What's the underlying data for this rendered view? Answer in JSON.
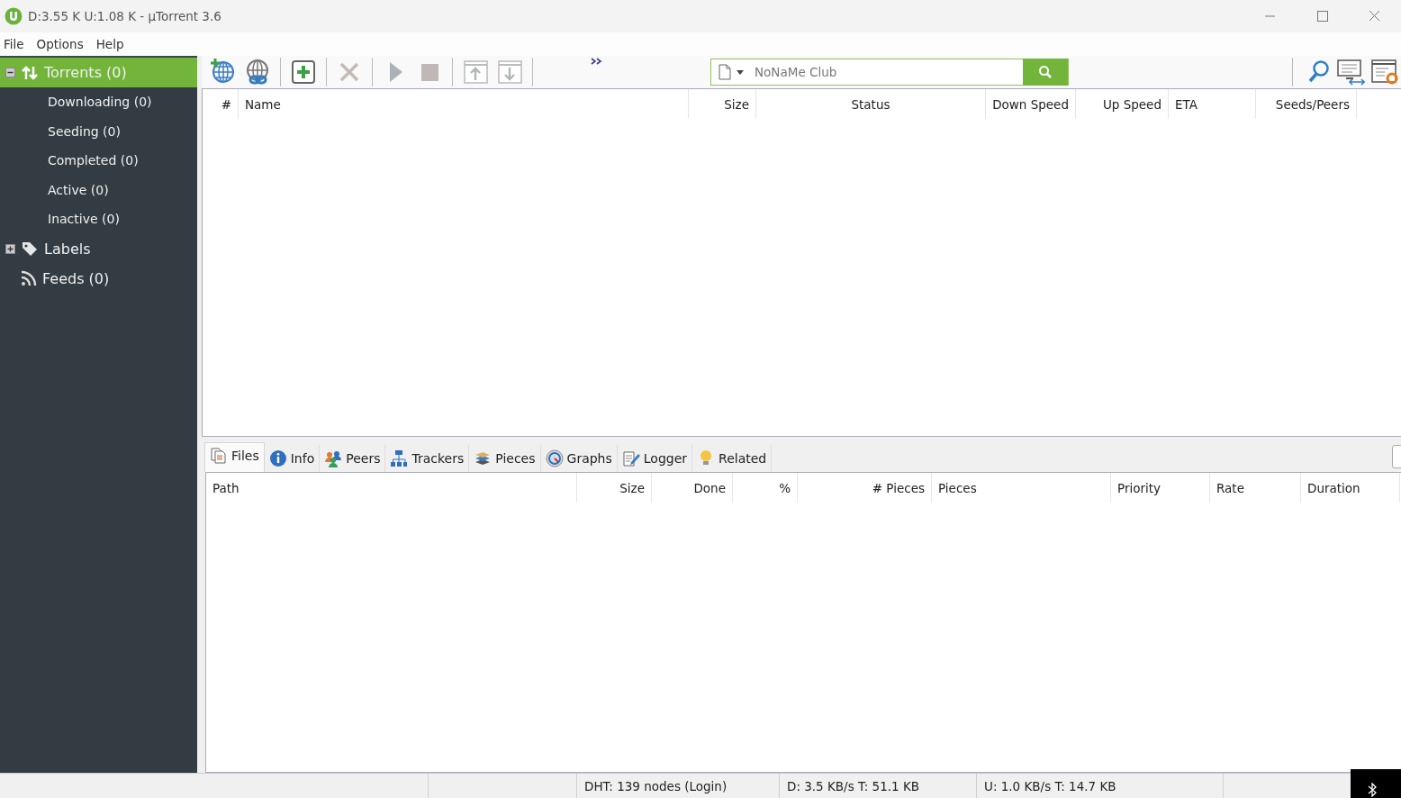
{
  "window": {
    "title": "D:3.55 K U:1.08 K - µTorrent 3.6"
  },
  "menu": [
    "File",
    "Options",
    "Help"
  ],
  "sidebar": {
    "items": [
      {
        "label": "Torrents (0)",
        "kind": "torrents",
        "selected": true,
        "expanded": true,
        "children": [
          {
            "label": "Downloading (0)",
            "selected": false
          },
          {
            "label": "Seeding (0)",
            "selected": false
          },
          {
            "label": "Completed (0)",
            "selected": false
          },
          {
            "label": "Active (0)",
            "selected": false
          },
          {
            "label": "Inactive (0)",
            "selected": false
          }
        ]
      },
      {
        "label": "Labels",
        "kind": "labels",
        "selected": false,
        "expanded": false
      },
      {
        "label": "Feeds (0)",
        "kind": "feeds",
        "selected": false
      }
    ]
  },
  "toolbar": {
    "buttons": [
      {
        "kind": "add-url",
        "disabled": false
      },
      {
        "kind": "add-link",
        "disabled": false
      },
      {
        "kind": "separator"
      },
      {
        "kind": "create",
        "disabled": false
      },
      {
        "kind": "separator"
      },
      {
        "kind": "remove",
        "disabled": true
      },
      {
        "kind": "separator"
      },
      {
        "kind": "start",
        "disabled": true
      },
      {
        "kind": "stop",
        "disabled": true
      },
      {
        "kind": "separator"
      },
      {
        "kind": "move-up",
        "disabled": true
      },
      {
        "kind": "move-down",
        "disabled": true
      },
      {
        "kind": "separator"
      },
      {
        "kind": "more"
      }
    ],
    "search": {
      "placeholder": "NoNaMe Club"
    }
  },
  "torrent_table": {
    "columns": [
      "#",
      "Name",
      "Size",
      "Status",
      "Down Speed",
      "Up Speed",
      "ETA",
      "Seeds/Peers"
    ]
  },
  "detail_tabs": [
    {
      "label": "Files",
      "kind": "files",
      "selected": true
    },
    {
      "label": "Info",
      "kind": "info",
      "selected": false
    },
    {
      "label": "Peers",
      "kind": "peers",
      "selected": false
    },
    {
      "label": "Trackers",
      "kind": "trackers",
      "selected": false
    },
    {
      "label": "Pieces",
      "kind": "pieces",
      "selected": false
    },
    {
      "label": "Graphs",
      "kind": "graphs",
      "selected": false
    },
    {
      "label": "Logger",
      "kind": "logger",
      "selected": false
    },
    {
      "label": "Related",
      "kind": "related",
      "selected": false
    }
  ],
  "files_table": {
    "columns": [
      "Path",
      "Size",
      "Done",
      "%",
      "# Pieces",
      "Pieces",
      "Priority",
      "Rate",
      "Duration"
    ]
  },
  "status_bar": [
    "DHT: 139 nodes (Login)",
    "D: 3.5 KB/s T: 51.1 KB",
    "U: 1.0 KB/s T: 14.7 KB"
  ]
}
